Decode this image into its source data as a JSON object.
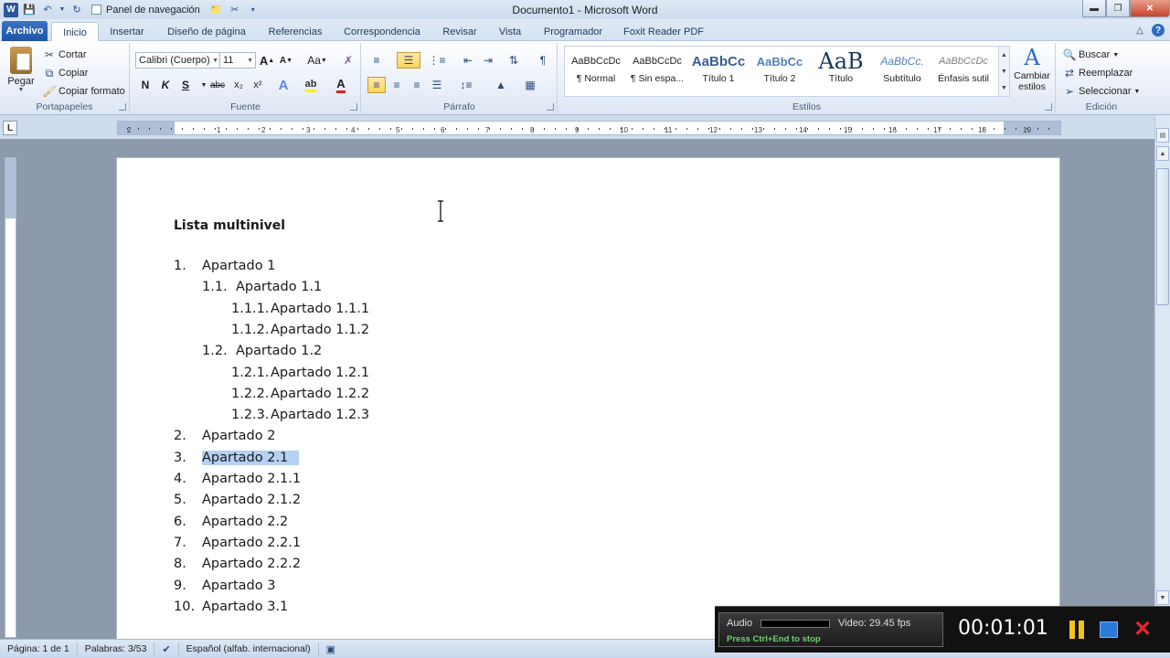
{
  "window": {
    "title": "Documento1 - Microsoft Word",
    "app_icon_label": "W",
    "nav_pane_label": "Panel de navegación"
  },
  "tabs": [
    "Archivo",
    "Inicio",
    "Insertar",
    "Diseño de página",
    "Referencias",
    "Correspondencia",
    "Revisar",
    "Vista",
    "Programador",
    "Foxit Reader PDF"
  ],
  "ribbon": {
    "clipboard": {
      "paste": "Pegar",
      "cut": "Cortar",
      "copy": "Copiar",
      "format_painter": "Copiar formato",
      "label": "Portapapeles"
    },
    "font": {
      "font_name": "Calibri (Cuerpo)",
      "font_size": "11",
      "label": "Fuente",
      "bold": "N",
      "italic": "K",
      "underline": "S",
      "strike": "abc",
      "subscript": "x₂",
      "superscript": "x²",
      "case": "Aa",
      "grow": "A",
      "shrink": "A"
    },
    "paragraph": {
      "label": "Párrafo"
    },
    "styles": {
      "label": "Estilos",
      "items": [
        {
          "sample": "AaBbCcDc",
          "name": "¶ Normal"
        },
        {
          "sample": "AaBbCcDc",
          "name": "¶ Sin espa..."
        },
        {
          "sample": "AaBbCc",
          "name": "Título 1"
        },
        {
          "sample": "AaBbCc",
          "name": "Título 2"
        },
        {
          "sample": "AaB",
          "name": "Título"
        },
        {
          "sample": "AaBbCc.",
          "name": "Subtítulo"
        },
        {
          "sample": "AaBbCcDc",
          "name": "Énfasis sutil"
        }
      ],
      "change": "Cambiar estilos"
    },
    "editing": {
      "label": "Edición",
      "find": "Buscar",
      "replace": "Reemplazar",
      "select": "Seleccionar"
    }
  },
  "ruler": {
    "ticks": [
      "1",
      "2",
      "1",
      "2",
      "3",
      "4",
      "5",
      "6",
      "7",
      "8",
      "9",
      "10",
      "11",
      "12",
      "13",
      "14",
      "15",
      "16",
      "17",
      "18",
      "19"
    ],
    "corner": "L"
  },
  "document": {
    "heading": "Lista multinivel",
    "items": [
      {
        "num": "1.",
        "text": "Apartado 1",
        "level": 0
      },
      {
        "num": "1.1.",
        "text": "Apartado 1.1",
        "level": 1
      },
      {
        "num": "1.1.1.",
        "text": "Apartado 1.1.1",
        "level": 2
      },
      {
        "num": "1.1.2.",
        "text": "Apartado 1.1.2",
        "level": 2
      },
      {
        "num": "1.2.",
        "text": "Apartado 1.2",
        "level": 1
      },
      {
        "num": "1.2.1.",
        "text": "Apartado 1.2.1",
        "level": 2
      },
      {
        "num": "1.2.2.",
        "text": "Apartado 1.2.2",
        "level": 2
      },
      {
        "num": "1.2.3.",
        "text": "Apartado 1.2.3",
        "level": 2
      },
      {
        "num": "2.",
        "text": "Apartado 2",
        "level": 0
      },
      {
        "num": "3.",
        "text": "Apartado 2.1",
        "level": 0,
        "selected": true
      },
      {
        "num": "4.",
        "text": "Apartado 2.1.1",
        "level": 0
      },
      {
        "num": "5.",
        "text": "Apartado 2.1.2",
        "level": 0
      },
      {
        "num": "6.",
        "text": "Apartado 2.2",
        "level": 0
      },
      {
        "num": "7.",
        "text": "Apartado 2.2.1",
        "level": 0
      },
      {
        "num": "8.",
        "text": "Apartado 2.2.2",
        "level": 0
      },
      {
        "num": "9.",
        "text": "Apartado 3",
        "level": 0
      },
      {
        "num": "10.",
        "text": "Apartado 3.1",
        "level": 0
      }
    ]
  },
  "status": {
    "page": "Página: 1 de 1",
    "words": "Palabras: 3/53",
    "language": "Español (alfab. internacional)"
  },
  "recorder": {
    "audio": "Audio",
    "video": "Video: 29.45 fps",
    "hint": "Press Ctrl+End to stop",
    "time": "00:01:01"
  },
  "colors": {
    "file_tab": "#2b5797",
    "selection": "#b5d1f3",
    "ribbon_bg": "#e7eef8"
  }
}
